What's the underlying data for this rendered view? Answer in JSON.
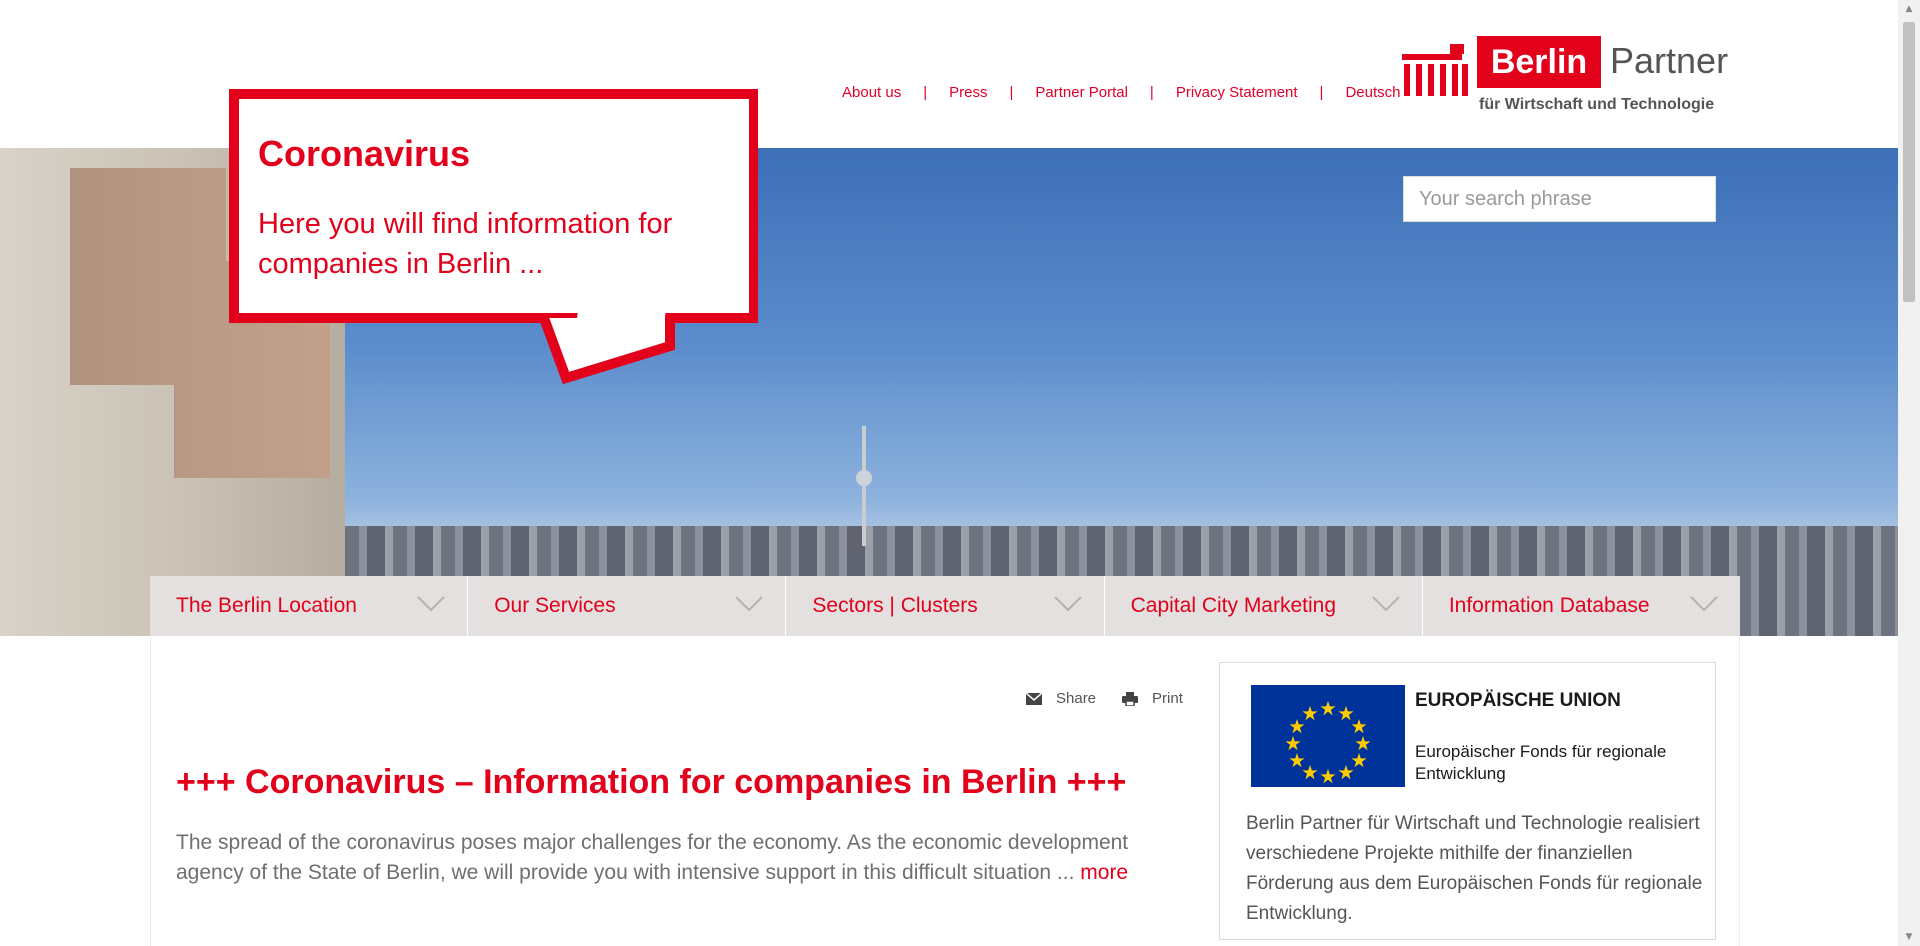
{
  "top_nav": {
    "items": [
      "About us",
      "Press",
      "Partner Portal",
      "Privacy Statement",
      "Deutsch"
    ],
    "separator": "|"
  },
  "logo": {
    "name": "Berlin",
    "partner": "Partner",
    "subtitle": "für Wirtschaft und Technologie"
  },
  "search": {
    "placeholder": "Your search phrase"
  },
  "bubble": {
    "title": "Coronavirus",
    "text": "Here you will find information for companies in Berlin ..."
  },
  "main_nav": {
    "items": [
      "The Berlin Location",
      "Our Services",
      "Sectors | Clusters",
      "Capital City Marketing",
      "Information Database"
    ]
  },
  "tools": {
    "share": "Share",
    "print": "Print"
  },
  "article": {
    "headline": "+++ Coronavirus – Information for companies in Berlin +++",
    "teaser": "The spread of the coronavirus poses major challenges for the economy. As the economic development agency of the State of Berlin, we will provide you with intensive support in this difficult situation ...",
    "more": "more"
  },
  "eu_box": {
    "title": "EUROPÄISCHE UNION",
    "subtitle": "Europäischer Fonds für regionale Entwicklung",
    "text": "Berlin Partner für Wirtschaft und Technologie realisiert verschiedene Projekte mithilfe der finanziellen Förderung aus dem Europäischen Fonds für regionale Entwicklung."
  },
  "colors": {
    "brand_red": "#e3001b",
    "nav_bg": "#e3e0df",
    "eu_blue": "#003399",
    "eu_gold": "#ffcc00"
  }
}
